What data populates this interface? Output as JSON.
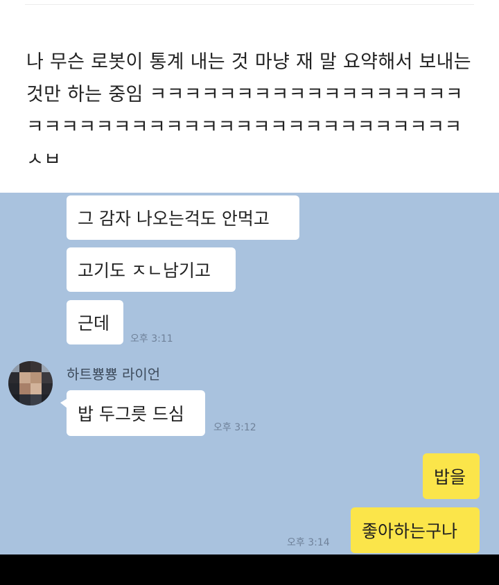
{
  "post": {
    "text": "나 무슨 로봇이 통계 내는 것 마냥 재 말 요약해서 보내는 것만 하는 중임 ㅋㅋㅋㅋㅋㅋㅋㅋㅋㅋㅋㅋㅋㅋㅋㅋㅋㅋㅋㅋㅋㅋㅋㅋㅋㅋㅋㅋㅋㅋㅋㅋㅋㅋㅋㅋㅋㅋㅋㅋㅋㅋㅋ ㅅㅂ"
  },
  "chat": {
    "background": "#a9c2de",
    "my_bubble_color": "#fbe54a",
    "messages": [
      {
        "text": "그 감자 나오는걱도 안먹고"
      },
      {
        "text": "고기도 ㅈㄴ남기고"
      },
      {
        "text": "근데",
        "time": "오후 3:11"
      },
      {
        "sender": "하트뿅뿅 라이언",
        "text": "밥 두그릇 드심",
        "time": "오후 3:12"
      },
      {
        "text": "밥을"
      },
      {
        "text": "좋아하는구나",
        "time": "오후 3:14"
      }
    ],
    "avatar_icon": "blurred-profile-avatar"
  }
}
